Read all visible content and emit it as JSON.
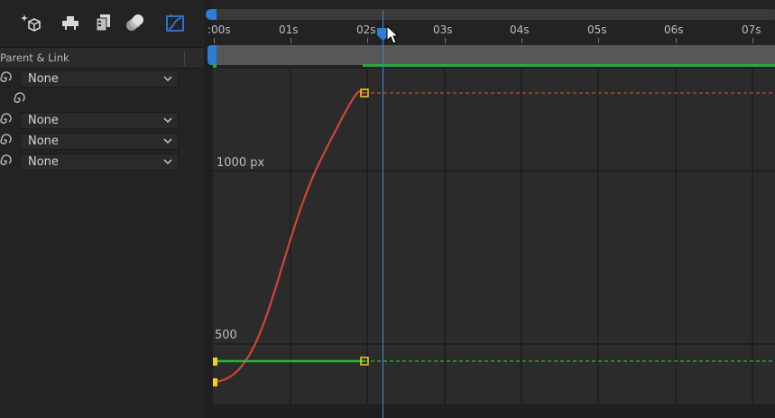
{
  "toolbar": {
    "icons": [
      "sparkle-cube-icon",
      "shape-stack-icon",
      "film-stack-icon",
      "motion-blur-icon",
      "graph-editor-icon"
    ],
    "accent": "#2d7cd6"
  },
  "layers_panel": {
    "column_header": "Parent & Link",
    "rows": [
      {
        "parent": "None",
        "has_dropdown": true
      },
      {
        "parent": "",
        "has_dropdown": false
      },
      {
        "parent": "None",
        "has_dropdown": true
      },
      {
        "parent": "None",
        "has_dropdown": true
      },
      {
        "parent": "None",
        "has_dropdown": true
      }
    ]
  },
  "timeline": {
    "ticks": [
      ":00s",
      "01s",
      "02s",
      "03s",
      "04s",
      "05s",
      "06s",
      "07s"
    ],
    "current_time": "02s"
  },
  "graph_editor": {
    "value_labels": [
      "1000 px",
      "500"
    ],
    "curve_colors": {
      "red": "#d0443a",
      "green": "#2fb43a",
      "keyframe": "#f2d21b"
    }
  }
}
